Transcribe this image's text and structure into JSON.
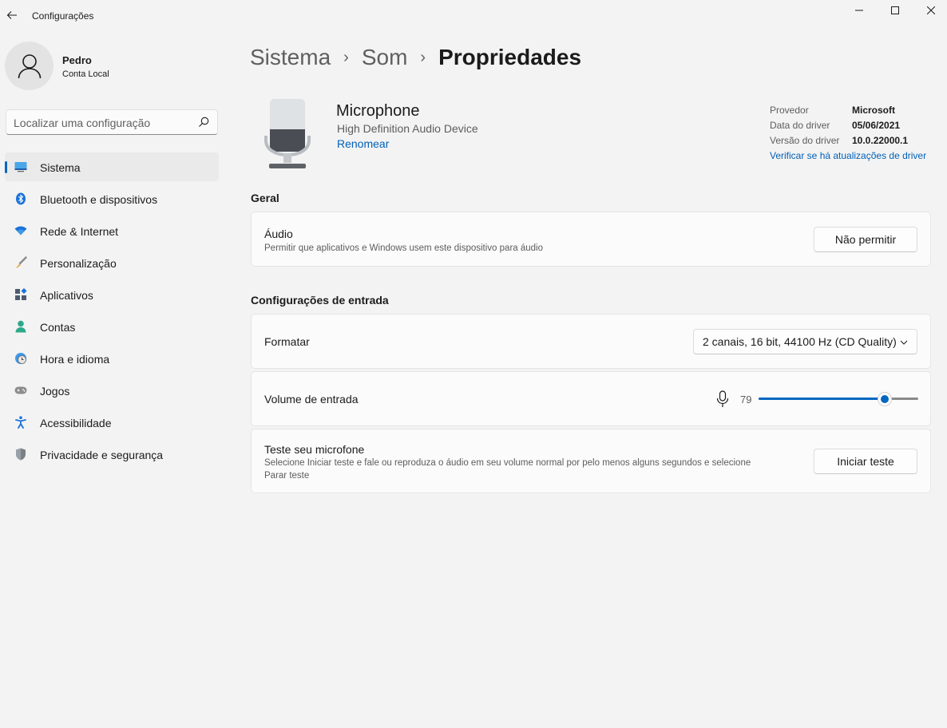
{
  "window": {
    "title": "Configurações",
    "back_icon": "arrow-left-icon",
    "minimize_icon": "minimize-icon",
    "maximize_icon": "maximize-icon",
    "close_icon": "close-icon"
  },
  "profile": {
    "name": "Pedro",
    "account_type": "Conta Local",
    "avatar_icon": "person-icon"
  },
  "search": {
    "placeholder": "Localizar uma configuração",
    "icon": "search-icon"
  },
  "sidebar": {
    "items": [
      {
        "label": "Sistema",
        "icon": "system-icon",
        "active": true
      },
      {
        "label": "Bluetooth e dispositivos",
        "icon": "bluetooth-icon",
        "active": false
      },
      {
        "label": "Rede & Internet",
        "icon": "wifi-icon",
        "active": false
      },
      {
        "label": "Personalização",
        "icon": "brush-icon",
        "active": false
      },
      {
        "label": "Aplicativos",
        "icon": "apps-icon",
        "active": false
      },
      {
        "label": "Contas",
        "icon": "accounts-icon",
        "active": false
      },
      {
        "label": "Hora e idioma",
        "icon": "clock-globe-icon",
        "active": false
      },
      {
        "label": "Jogos",
        "icon": "gamepad-icon",
        "active": false
      },
      {
        "label": "Acessibilidade",
        "icon": "accessibility-icon",
        "active": false
      },
      {
        "label": "Privacidade e segurança",
        "icon": "shield-icon",
        "active": false
      }
    ]
  },
  "breadcrumb": {
    "items": [
      "Sistema",
      "Som"
    ],
    "current": "Propriedades",
    "separator": "›"
  },
  "device": {
    "name": "Microphone",
    "description": "High Definition Audio Device",
    "rename_label": "Renomear",
    "icon": "microphone-icon"
  },
  "driver": {
    "rows": [
      {
        "key": "Provedor",
        "value": "Microsoft"
      },
      {
        "key": "Data do driver",
        "value": "05/06/2021"
      },
      {
        "key": "Versão do driver",
        "value": "10.0.22000.1"
      }
    ],
    "update_link": "Verificar se há atualizações de driver"
  },
  "general": {
    "section_title": "Geral",
    "audio": {
      "title": "Áudio",
      "description": "Permitir que aplicativos e Windows usem este dispositivo para áudio",
      "button_label": "Não permitir"
    }
  },
  "input_settings": {
    "section_title": "Configurações de entrada",
    "format": {
      "title": "Formatar",
      "selected": "2 canais, 16 bit, 44100 Hz (CD Quality)"
    },
    "volume": {
      "title": "Volume de entrada",
      "value": "79",
      "level": 79,
      "max": 100
    },
    "test": {
      "title": "Teste seu microfone",
      "description_line1": "Selecione Iniciar teste e fale ou reproduza o áudio em seu volume normal por pelo menos alguns segundos e selecione",
      "description_line2": "Parar teste",
      "button_label": "Iniciar teste"
    }
  },
  "colors": {
    "accent": "#0067c0",
    "background": "#f3f3f3",
    "card": "#fbfbfb",
    "link": "#0060b8"
  }
}
